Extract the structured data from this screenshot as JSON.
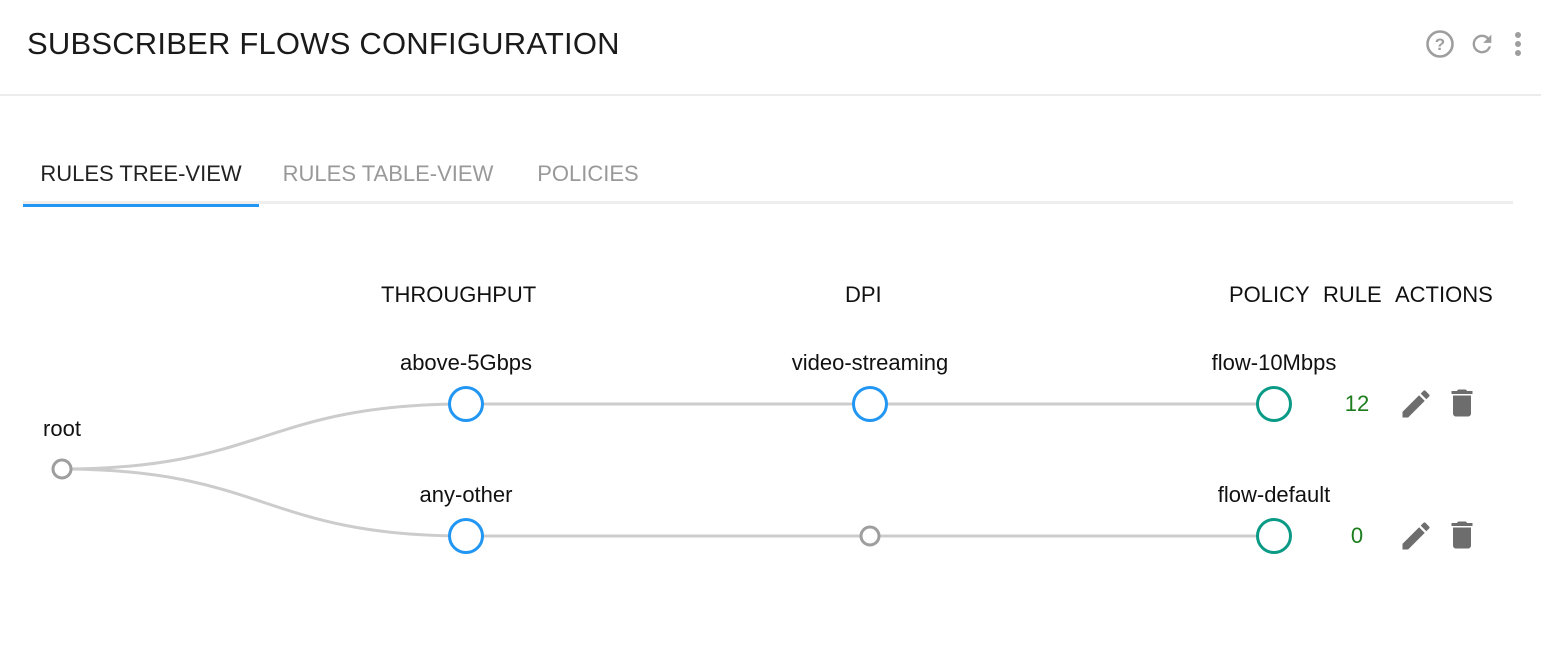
{
  "header": {
    "title": "SUBSCRIBER FLOWS CONFIGURATION",
    "icons": [
      "help-icon",
      "refresh-icon",
      "more-vertical-icon"
    ]
  },
  "tabs": [
    {
      "label": "RULES TREE-VIEW",
      "active": true
    },
    {
      "label": "RULES TABLE-VIEW",
      "active": false
    },
    {
      "label": "POLICIES",
      "active": false
    }
  ],
  "tree": {
    "columns": {
      "throughput": "THROUGHPUT",
      "dpi": "DPI",
      "policy": "POLICY",
      "rule": "RULE",
      "actions": "ACTIONS"
    },
    "root_label": "root",
    "rows": [
      {
        "throughput": "above-5Gbps",
        "dpi": "video-streaming",
        "policy": "flow-10Mbps",
        "rule": "12"
      },
      {
        "throughput": "any-other",
        "dpi": "",
        "policy": "flow-default",
        "rule": "0"
      }
    ]
  },
  "colors": {
    "accent": "#2196f3",
    "policy_node": "#0a9a86",
    "empty_node": "#9e9e9e",
    "link": "#cccccc",
    "rule_count": "#1b7d1b",
    "action_icon": "#6d6d6d"
  }
}
